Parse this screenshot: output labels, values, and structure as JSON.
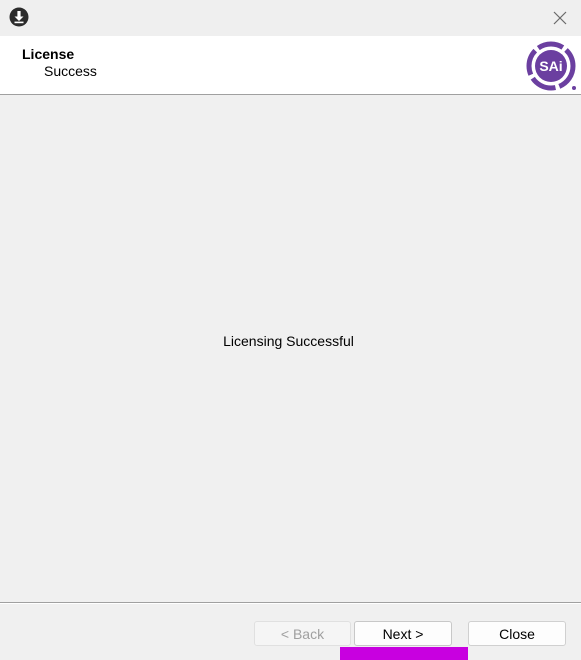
{
  "window": {
    "app_icon": "download-icon",
    "close_icon": "close-icon"
  },
  "header": {
    "title": "License",
    "subtitle": "Success",
    "logo_text": "SAi",
    "logo_color": "#6b3fa0"
  },
  "content": {
    "message": "Licensing Successful"
  },
  "footer": {
    "back_label": "< Back",
    "next_label": "Next >",
    "close_label": "Close"
  },
  "colors": {
    "accent_bar": "#c800e0"
  }
}
